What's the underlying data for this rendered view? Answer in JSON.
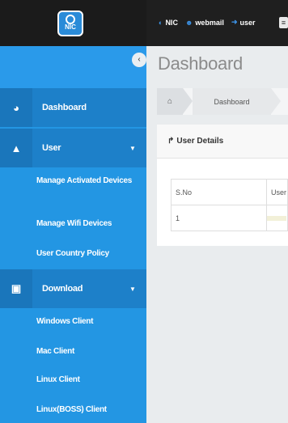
{
  "brand": {
    "logo_text": "NIC"
  },
  "topbar": {
    "links": [
      {
        "icon": "nic-link-icon",
        "label": "NIC"
      },
      {
        "icon": "user-group-icon",
        "label": "webmail"
      },
      {
        "icon": "sign-in-icon",
        "label": "user"
      }
    ]
  },
  "sidebar": {
    "items": [
      {
        "icon": "dashboard-icon",
        "label": "Dashboard"
      },
      {
        "icon": "user-icon",
        "label": "User",
        "submenu": [
          "Manage Activated Devices",
          "Manage Wifi Devices",
          "User Country Policy"
        ]
      },
      {
        "icon": "save-icon",
        "label": "Download",
        "submenu": [
          "Windows Client",
          "Mac Client",
          "Linux Client",
          "Linux(BOSS) Client"
        ]
      }
    ]
  },
  "main": {
    "title": "Dashboard",
    "breadcrumb": {
      "current": "Dashboard"
    },
    "panel": {
      "title": "User Details",
      "table": {
        "headers": [
          "S.No",
          "User"
        ],
        "rows": [
          [
            "1",
            ""
          ]
        ]
      }
    }
  },
  "colors": {
    "sidebar": "#2396e3",
    "sidebar_dark": "#1d80c9",
    "topbar": "#1f1f1f",
    "accent": "#3b8fe0"
  }
}
